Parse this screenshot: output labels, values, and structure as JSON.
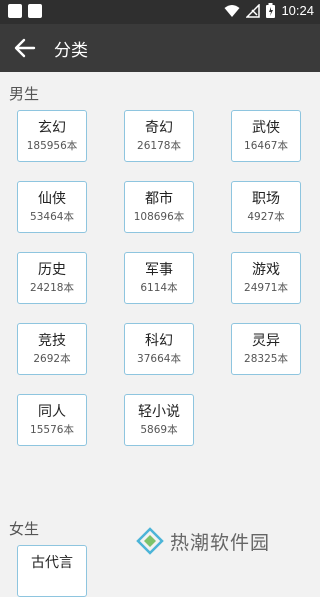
{
  "status_bar": {
    "time": "10:24"
  },
  "app_bar": {
    "title": "分类"
  },
  "sections": [
    {
      "title": "男生",
      "items": [
        {
          "name": "玄幻",
          "count": "185956本"
        },
        {
          "name": "奇幻",
          "count": "26178本"
        },
        {
          "name": "武侠",
          "count": "16467本"
        },
        {
          "name": "仙侠",
          "count": "53464本"
        },
        {
          "name": "都市",
          "count": "108696本"
        },
        {
          "name": "职场",
          "count": "4927本"
        },
        {
          "name": "历史",
          "count": "24218本"
        },
        {
          "name": "军事",
          "count": "6114本"
        },
        {
          "name": "游戏",
          "count": "24971本"
        },
        {
          "name": "竞技",
          "count": "2692本"
        },
        {
          "name": "科幻",
          "count": "37664本"
        },
        {
          "name": "灵异",
          "count": "28325本"
        },
        {
          "name": "同人",
          "count": "15576本"
        },
        {
          "name": "轻小说",
          "count": "5869本"
        }
      ]
    },
    {
      "title": "女生",
      "items": [
        {
          "name": "古代言",
          "count": ""
        }
      ]
    }
  ],
  "watermark": {
    "text": "热潮软件园"
  },
  "colors": {
    "appbar": "#3a3a3a",
    "card_border": "#8ec5df"
  }
}
